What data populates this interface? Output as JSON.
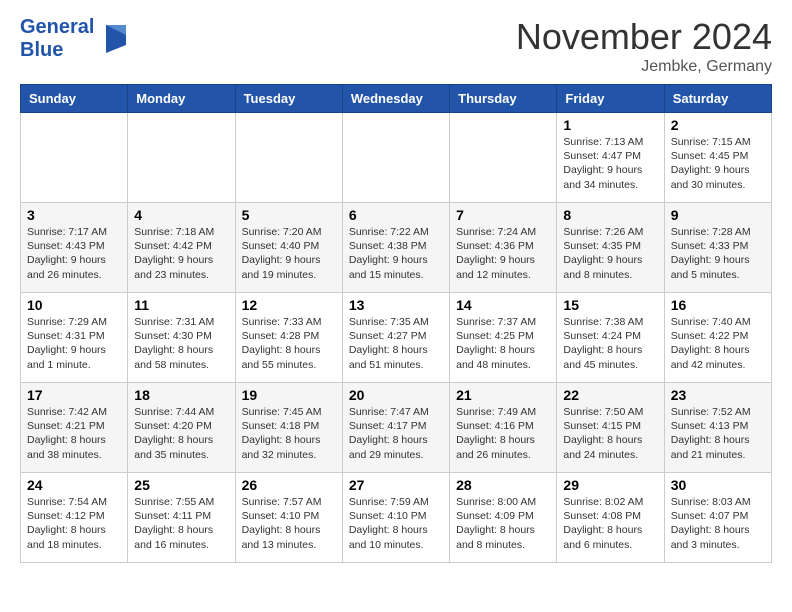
{
  "header": {
    "title": "November 2024",
    "location": "Jembke, Germany"
  },
  "columns": [
    "Sunday",
    "Monday",
    "Tuesday",
    "Wednesday",
    "Thursday",
    "Friday",
    "Saturday"
  ],
  "weeks": [
    [
      {
        "day": "",
        "info": ""
      },
      {
        "day": "",
        "info": ""
      },
      {
        "day": "",
        "info": ""
      },
      {
        "day": "",
        "info": ""
      },
      {
        "day": "",
        "info": ""
      },
      {
        "day": "1",
        "info": "Sunrise: 7:13 AM\nSunset: 4:47 PM\nDaylight: 9 hours\nand 34 minutes."
      },
      {
        "day": "2",
        "info": "Sunrise: 7:15 AM\nSunset: 4:45 PM\nDaylight: 9 hours\nand 30 minutes."
      }
    ],
    [
      {
        "day": "3",
        "info": "Sunrise: 7:17 AM\nSunset: 4:43 PM\nDaylight: 9 hours\nand 26 minutes."
      },
      {
        "day": "4",
        "info": "Sunrise: 7:18 AM\nSunset: 4:42 PM\nDaylight: 9 hours\nand 23 minutes."
      },
      {
        "day": "5",
        "info": "Sunrise: 7:20 AM\nSunset: 4:40 PM\nDaylight: 9 hours\nand 19 minutes."
      },
      {
        "day": "6",
        "info": "Sunrise: 7:22 AM\nSunset: 4:38 PM\nDaylight: 9 hours\nand 15 minutes."
      },
      {
        "day": "7",
        "info": "Sunrise: 7:24 AM\nSunset: 4:36 PM\nDaylight: 9 hours\nand 12 minutes."
      },
      {
        "day": "8",
        "info": "Sunrise: 7:26 AM\nSunset: 4:35 PM\nDaylight: 9 hours\nand 8 minutes."
      },
      {
        "day": "9",
        "info": "Sunrise: 7:28 AM\nSunset: 4:33 PM\nDaylight: 9 hours\nand 5 minutes."
      }
    ],
    [
      {
        "day": "10",
        "info": "Sunrise: 7:29 AM\nSunset: 4:31 PM\nDaylight: 9 hours\nand 1 minute."
      },
      {
        "day": "11",
        "info": "Sunrise: 7:31 AM\nSunset: 4:30 PM\nDaylight: 8 hours\nand 58 minutes."
      },
      {
        "day": "12",
        "info": "Sunrise: 7:33 AM\nSunset: 4:28 PM\nDaylight: 8 hours\nand 55 minutes."
      },
      {
        "day": "13",
        "info": "Sunrise: 7:35 AM\nSunset: 4:27 PM\nDaylight: 8 hours\nand 51 minutes."
      },
      {
        "day": "14",
        "info": "Sunrise: 7:37 AM\nSunset: 4:25 PM\nDaylight: 8 hours\nand 48 minutes."
      },
      {
        "day": "15",
        "info": "Sunrise: 7:38 AM\nSunset: 4:24 PM\nDaylight: 8 hours\nand 45 minutes."
      },
      {
        "day": "16",
        "info": "Sunrise: 7:40 AM\nSunset: 4:22 PM\nDaylight: 8 hours\nand 42 minutes."
      }
    ],
    [
      {
        "day": "17",
        "info": "Sunrise: 7:42 AM\nSunset: 4:21 PM\nDaylight: 8 hours\nand 38 minutes."
      },
      {
        "day": "18",
        "info": "Sunrise: 7:44 AM\nSunset: 4:20 PM\nDaylight: 8 hours\nand 35 minutes."
      },
      {
        "day": "19",
        "info": "Sunrise: 7:45 AM\nSunset: 4:18 PM\nDaylight: 8 hours\nand 32 minutes."
      },
      {
        "day": "20",
        "info": "Sunrise: 7:47 AM\nSunset: 4:17 PM\nDaylight: 8 hours\nand 29 minutes."
      },
      {
        "day": "21",
        "info": "Sunrise: 7:49 AM\nSunset: 4:16 PM\nDaylight: 8 hours\nand 26 minutes."
      },
      {
        "day": "22",
        "info": "Sunrise: 7:50 AM\nSunset: 4:15 PM\nDaylight: 8 hours\nand 24 minutes."
      },
      {
        "day": "23",
        "info": "Sunrise: 7:52 AM\nSunset: 4:13 PM\nDaylight: 8 hours\nand 21 minutes."
      }
    ],
    [
      {
        "day": "24",
        "info": "Sunrise: 7:54 AM\nSunset: 4:12 PM\nDaylight: 8 hours\nand 18 minutes."
      },
      {
        "day": "25",
        "info": "Sunrise: 7:55 AM\nSunset: 4:11 PM\nDaylight: 8 hours\nand 16 minutes."
      },
      {
        "day": "26",
        "info": "Sunrise: 7:57 AM\nSunset: 4:10 PM\nDaylight: 8 hours\nand 13 minutes."
      },
      {
        "day": "27",
        "info": "Sunrise: 7:59 AM\nSunset: 4:10 PM\nDaylight: 8 hours\nand 10 minutes."
      },
      {
        "day": "28",
        "info": "Sunrise: 8:00 AM\nSunset: 4:09 PM\nDaylight: 8 hours\nand 8 minutes."
      },
      {
        "day": "29",
        "info": "Sunrise: 8:02 AM\nSunset: 4:08 PM\nDaylight: 8 hours\nand 6 minutes."
      },
      {
        "day": "30",
        "info": "Sunrise: 8:03 AM\nSunset: 4:07 PM\nDaylight: 8 hours\nand 3 minutes."
      }
    ]
  ]
}
